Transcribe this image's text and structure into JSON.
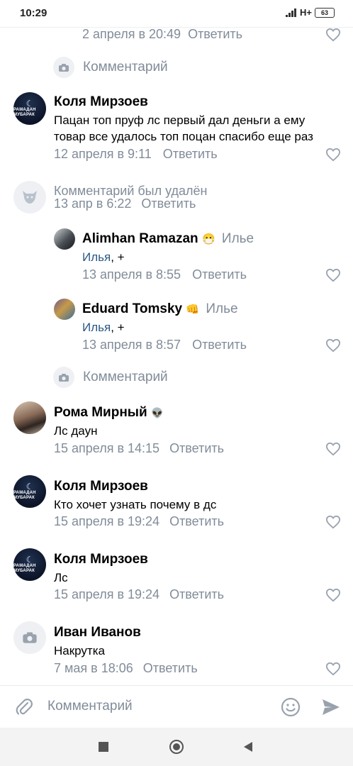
{
  "status": {
    "time": "10:29",
    "network": "H+",
    "battery": "63"
  },
  "top_meta": {
    "date": "2 апреля в 20:49",
    "reply": "Ответить"
  },
  "comment_placeholder_1": "Комментарий",
  "comments": [
    {
      "author": "Коля Мирзоев",
      "avatar_text": "РАМАДАН МУБАРАК",
      "line1": "Пацан топ пруф лс первый дал деньги а ему",
      "line2": "товар все удалось топ поцан спасибо еще раз",
      "date": "12 апреля в 9:11",
      "reply": "Ответить"
    },
    {
      "deleted_text": "Комментарий был удалён",
      "date": "13 апр в 6:22",
      "reply": "Ответить"
    }
  ],
  "replies": [
    {
      "author": "Alimhan Ramazan",
      "emoji": "😷",
      "to": "Илье",
      "mention": "Илья",
      "text": ", +",
      "date": "13 апреля в 8:55",
      "reply": "Ответить"
    },
    {
      "author": "Eduard Tomsky",
      "emoji": "👊",
      "to": "Илье",
      "mention": "Илья",
      "text": ", +",
      "date": "13 апреля в 8:57",
      "reply": "Ответить"
    }
  ],
  "comment_placeholder_2": "Комментарий",
  "comments2": [
    {
      "author": "Рома Мирный",
      "emoji": "👽",
      "text": "Лс даун",
      "date": "15 апреля в 14:15",
      "reply": "Ответить"
    },
    {
      "author": "Коля Мирзоев",
      "text": "Кто хочет узнать почему в дс",
      "date": "15 апреля в 19:24",
      "reply": "Ответить"
    },
    {
      "author": "Коля Мирзоев",
      "text": "Лс",
      "date": "15 апреля в 19:24",
      "reply": "Ответить"
    },
    {
      "author": "Иван Иванов",
      "text": "Накрутка",
      "date": "7 мая в 18:06",
      "reply": "Ответить"
    }
  ],
  "input": {
    "placeholder": "Комментарий"
  },
  "icons": {
    "attach": "paperclip-icon",
    "emoji": "smiley-icon",
    "send": "send-icon",
    "like": "heart-icon",
    "camera": "camera-icon",
    "deleted_avatar": "vk-dog-icon",
    "nav_back": "triangle-back-icon",
    "nav_home": "circle-home-icon",
    "nav_recent": "square-recent-icon"
  },
  "colors": {
    "meta": "#818c99",
    "link": "#2a5885",
    "accent": "#99a2ad"
  }
}
